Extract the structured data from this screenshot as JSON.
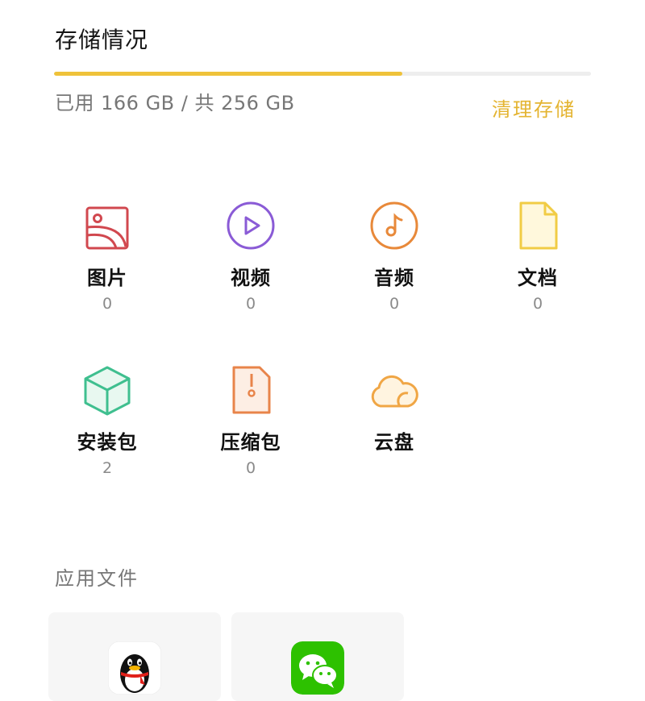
{
  "storage": {
    "title": "存储情况",
    "used_fraction": 0.648,
    "usage_text": "已用 166 GB / 共 256 GB",
    "clean_label": "清理存储",
    "accent_color": "#efc23a"
  },
  "categories": [
    {
      "label": "图片",
      "count": "0",
      "icon": "image-icon",
      "color": "#d1484f"
    },
    {
      "label": "视频",
      "count": "0",
      "icon": "video-play-icon",
      "color": "#8a5bd6"
    },
    {
      "label": "音频",
      "count": "0",
      "icon": "music-note-icon",
      "color": "#e8893a"
    },
    {
      "label": "文档",
      "count": "0",
      "icon": "document-icon",
      "color": "#f1cc45"
    },
    {
      "label": "安装包",
      "count": "2",
      "icon": "package-cube-icon",
      "color": "#3fbf8f"
    },
    {
      "label": "压缩包",
      "count": "0",
      "icon": "zip-file-icon",
      "color": "#e8844a"
    },
    {
      "label": "云盘",
      "count": "",
      "icon": "cloud-icon",
      "color": "#f0a645"
    }
  ],
  "app_files": {
    "title": "应用文件",
    "apps": [
      {
        "icon": "qq-penguin-icon"
      },
      {
        "icon": "wechat-icon"
      }
    ]
  }
}
